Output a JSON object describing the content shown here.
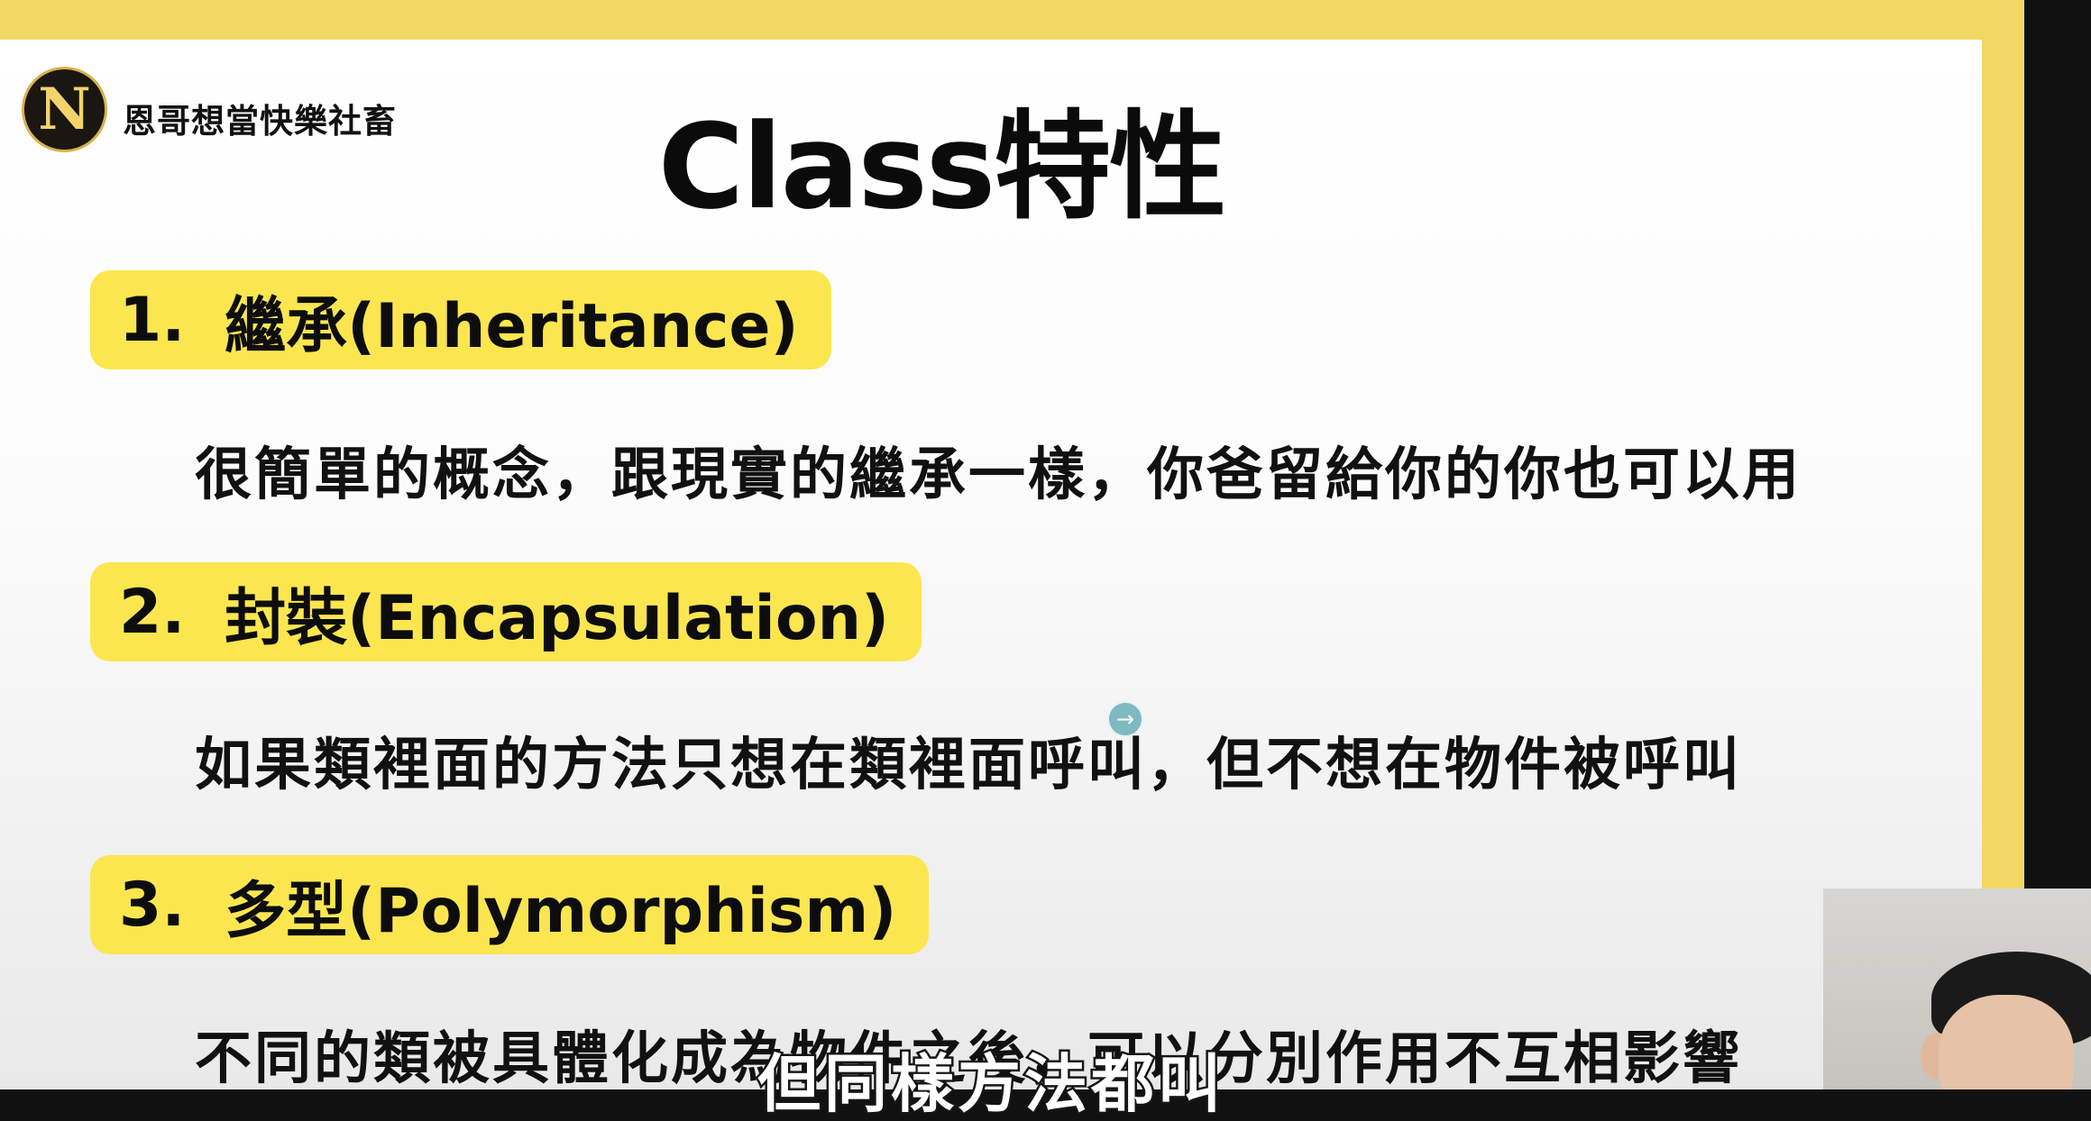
{
  "channel": {
    "name": "恩哥想當快樂社畜",
    "logo_letters": "N"
  },
  "slide": {
    "title": "Class特性",
    "items": [
      {
        "number": "1.",
        "heading": "繼承(Inheritance)",
        "description": "很簡單的概念，跟現實的繼承一樣，你爸留給你的你也可以用"
      },
      {
        "number": "2.",
        "heading": "封裝(Encapsulation)",
        "description": "如果類裡面的方法只想在類裡面呼叫，但不想在物件被呼叫"
      },
      {
        "number": "3.",
        "heading": "多型(Polymorphism)",
        "description": "不同的類被具體化成為物件之後，可以分別作用不互相影響"
      }
    ]
  },
  "subtitle": "但同樣方法都叫",
  "colors": {
    "frame": "#f1d865",
    "highlight": "#fbe650",
    "text": "#111111"
  },
  "icons": {
    "cursor": "cursor-arrow-icon"
  }
}
